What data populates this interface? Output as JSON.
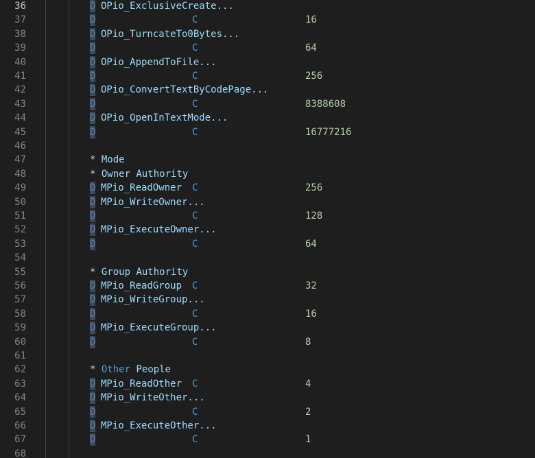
{
  "colors": {
    "background": "#1e1e1e",
    "line_number": "#858585",
    "active_line_number": "#c6c6c6",
    "keyword": "#569cd6",
    "identifier": "#9cdcfe",
    "number": "#b5cea8"
  },
  "lines": [
    {
      "num": "36",
      "d": "D",
      "name": "OPio_ExclusiveCreate...",
      "c": "",
      "val": ""
    },
    {
      "num": "37",
      "d": "D",
      "name": "",
      "c": "C",
      "val": "16"
    },
    {
      "num": "38",
      "d": "D",
      "name": "OPio_TurncateTo0Bytes...",
      "c": "",
      "val": ""
    },
    {
      "num": "39",
      "d": "D",
      "name": "",
      "c": "C",
      "val": "64"
    },
    {
      "num": "40",
      "d": "D",
      "name": "OPio_AppendToFile...",
      "c": "",
      "val": ""
    },
    {
      "num": "41",
      "d": "D",
      "name": "",
      "c": "C",
      "val": "256"
    },
    {
      "num": "42",
      "d": "D",
      "name": "OPio_ConvertTextByCodePage...",
      "c": "",
      "val": ""
    },
    {
      "num": "43",
      "d": "D",
      "name": "",
      "c": "C",
      "val": "8388608"
    },
    {
      "num": "44",
      "d": "D",
      "name": "OPio_OpenInTextMode...",
      "c": "",
      "val": ""
    },
    {
      "num": "45",
      "d": "D",
      "name": "",
      "c": "C",
      "val": "16777216"
    },
    {
      "num": "46"
    },
    {
      "num": "47",
      "star": "*",
      "comment": "Mode"
    },
    {
      "num": "48",
      "star": "*",
      "comment": "Owner Authority"
    },
    {
      "num": "49",
      "d": "D",
      "name": "MPio_ReadOwner",
      "c": "C",
      "val": "256"
    },
    {
      "num": "50",
      "d": "D",
      "name": "MPio_WriteOwner...",
      "c": "",
      "val": ""
    },
    {
      "num": "51",
      "d": "D",
      "name": "",
      "c": "C",
      "val": "128"
    },
    {
      "num": "52",
      "d": "D",
      "name": "MPio_ExecuteOwner...",
      "c": "",
      "val": ""
    },
    {
      "num": "53",
      "d": "D",
      "name": "",
      "c": "C",
      "val": "64"
    },
    {
      "num": "54"
    },
    {
      "num": "55",
      "star": "*",
      "comment": "Group Authority"
    },
    {
      "num": "56",
      "d": "D",
      "name": "MPio_ReadGroup",
      "c": "C",
      "val": "32"
    },
    {
      "num": "57",
      "d": "D",
      "name": "MPio_WriteGroup...",
      "c": "",
      "val": ""
    },
    {
      "num": "58",
      "d": "D",
      "name": "",
      "c": "C",
      "val": "16"
    },
    {
      "num": "59",
      "d": "D",
      "name": "MPio_ExecuteGroup...",
      "c": "",
      "val": ""
    },
    {
      "num": "60",
      "d": "D",
      "name": "",
      "c": "C",
      "val": "8"
    },
    {
      "num": "61"
    },
    {
      "num": "62",
      "star": "*",
      "comment_kw": "Other",
      "comment": "People"
    },
    {
      "num": "63",
      "d": "D",
      "name": "MPio_ReadOther",
      "c": "C",
      "val": "4"
    },
    {
      "num": "64",
      "d": "D",
      "name": "MPio_WriteOther...",
      "c": "",
      "val": ""
    },
    {
      "num": "65",
      "d": "D",
      "name": "",
      "c": "C",
      "val": "2"
    },
    {
      "num": "66",
      "d": "D",
      "name": "MPio_ExecuteOther...",
      "c": "",
      "val": ""
    },
    {
      "num": "67",
      "d": "D",
      "name": "",
      "c": "C",
      "val": "1"
    },
    {
      "num": "68"
    }
  ],
  "active_line": "36"
}
